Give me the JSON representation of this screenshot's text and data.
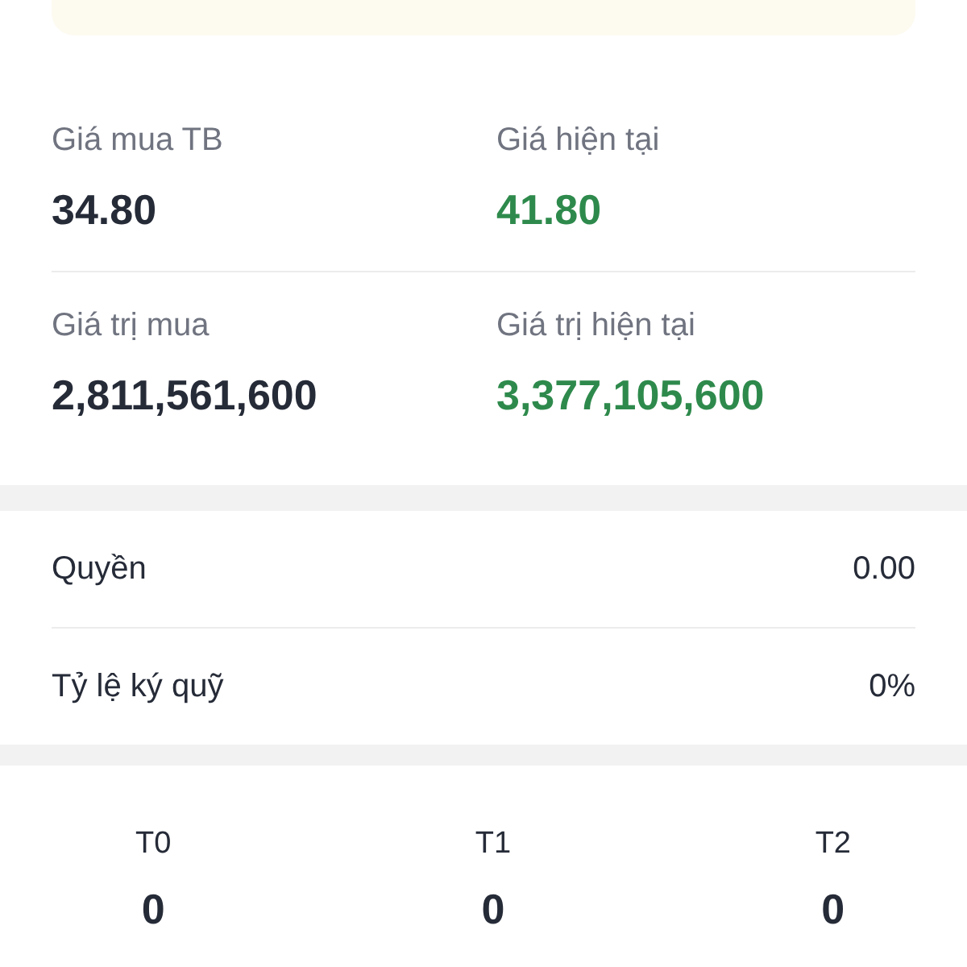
{
  "stats": [
    {
      "label": "Giá mua TB",
      "value": "34.80",
      "kind": "neutral"
    },
    {
      "label": "Giá hiện tại",
      "value": "41.80",
      "kind": "up"
    },
    {
      "label": "Giá trị mua",
      "value": "2,811,561,600",
      "kind": "neutral"
    },
    {
      "label": "Giá trị hiện tại",
      "value": "3,377,105,600",
      "kind": "up"
    }
  ],
  "details": [
    {
      "label": "Quyền",
      "value": "0.00"
    },
    {
      "label": "Tỷ lệ ký quỹ",
      "value": "0%"
    }
  ],
  "settlement": [
    {
      "label": "T0",
      "value": "0"
    },
    {
      "label": "T1",
      "value": "0"
    },
    {
      "label": "T2",
      "value": "0"
    }
  ]
}
